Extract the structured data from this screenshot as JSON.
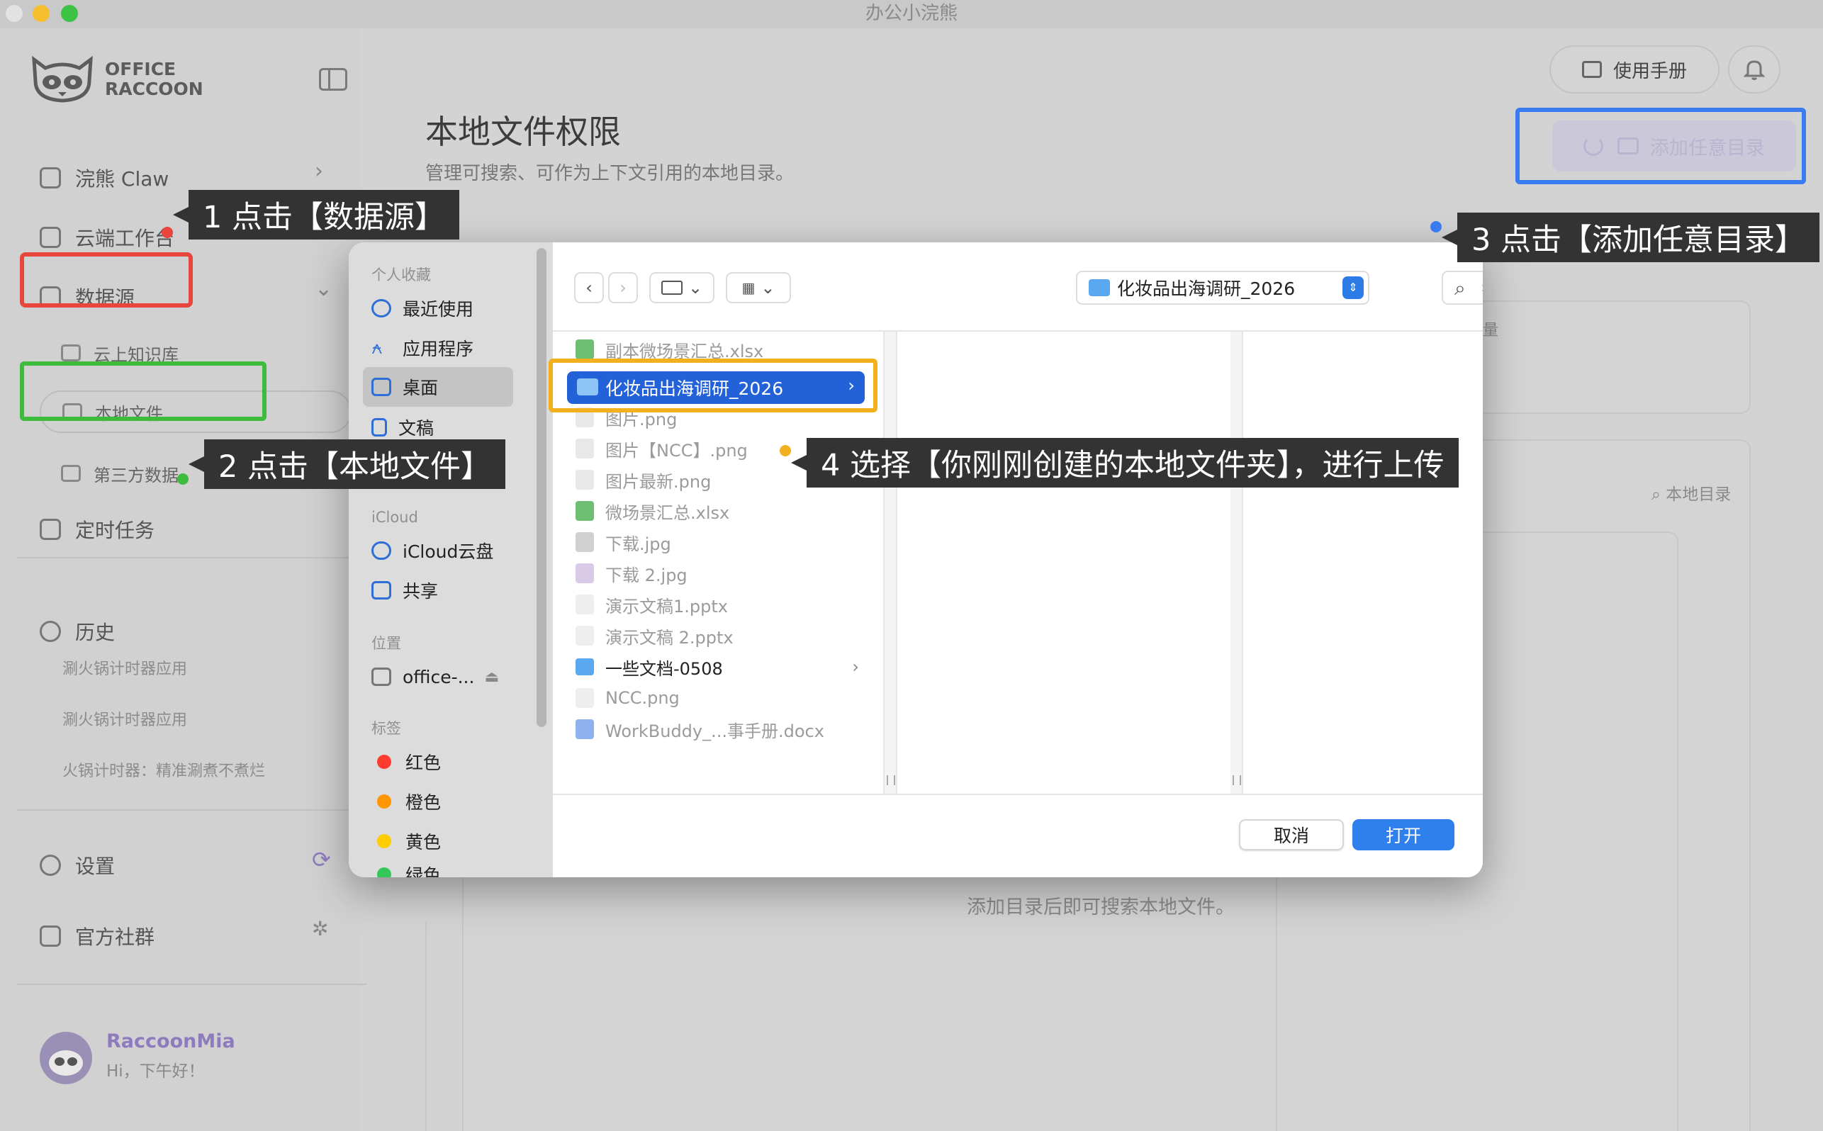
{
  "window": {
    "title": "办公小浣熊"
  },
  "brand": {
    "line1": "OFFICE",
    "line2": "RACCOON"
  },
  "sidebar": {
    "nav": [
      {
        "label": "浣熊 Claw"
      },
      {
        "label": "云端工作台"
      },
      {
        "label": "数据源"
      }
    ],
    "sub": [
      {
        "label": "云上知识库"
      },
      {
        "label": "本地文件"
      },
      {
        "label": "第三方数据"
      }
    ],
    "scheduled": "定时任务",
    "history_title": "历史",
    "history": [
      "涮火锅计时器应用",
      "涮火锅计时器应用",
      "火锅计时器：精准涮煮不煮烂"
    ],
    "settings": "设置",
    "community": "官方社群",
    "user": {
      "name": "RaccoonMia",
      "greeting": "Hi，下午好！"
    }
  },
  "main": {
    "title": "本地文件权限",
    "subtitle": "管理可搜索、可作为上下文引用的本地目录。",
    "manual_button": "使用手册",
    "add_button": "添加任意目录",
    "search_local": "本地目录",
    "empty_text": "添加目录后即可搜索本地文件。",
    "card_label": "量"
  },
  "dialog": {
    "favorites_title": "个人收藏",
    "favorites": [
      "最近使用",
      "应用程序",
      "桌面",
      "文稿"
    ],
    "icloud_title": "iCloud",
    "icloud": [
      "iCloud云盘",
      "共享"
    ],
    "locations_title": "位置",
    "locations": [
      "office-..."
    ],
    "tags_title": "标签",
    "tags": [
      {
        "label": "红色",
        "color": "#ff3b30"
      },
      {
        "label": "橙色",
        "color": "#ff9500"
      },
      {
        "label": "黄色",
        "color": "#ffcc00"
      },
      {
        "label": "绿色",
        "color": "#34c759"
      }
    ],
    "path": "化妆品出海调研_2026",
    "search_placeholder": "搜索",
    "selected_folder": "化妆品出海调研_2026",
    "files": [
      "副本微场景汇总.xlsx",
      "图片.png",
      "图片【NCC】.png",
      "图片最新.png",
      "微场景汇总.xlsx",
      "下载.jpg",
      "下载 2.jpg",
      "演示文稿1.pptx",
      "演示文稿 2.pptx",
      "一些文档-0508",
      "NCC.png",
      "WorkBuddy_...事手册.docx"
    ],
    "cancel": "取消",
    "open": "打开"
  },
  "annotations": {
    "step1": "1 点击【数据源】",
    "step2": "2 点击【本地文件】",
    "step3": "3 点击【添加任意目录】",
    "step4": "4 选择【你刚刚创建的本地文件夹】，进行上传"
  },
  "colors": {
    "highlight_red": "#e8453c",
    "highlight_green": "#3dbb3d",
    "highlight_blue": "#3a7bf2",
    "highlight_yellow": "#f2b01e",
    "accent": "#2f80ed"
  }
}
